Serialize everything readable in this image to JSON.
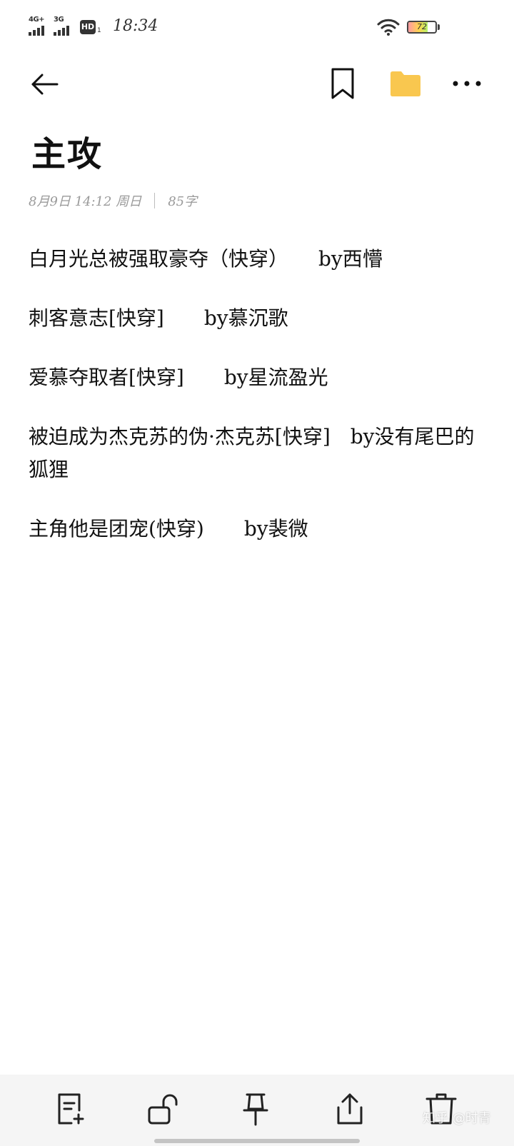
{
  "status_bar": {
    "network_1": "4G+",
    "network_2": "3G",
    "hd_label": "HD",
    "hd_sub": "1",
    "time": "18:34",
    "battery_level": "72",
    "battery_fraction": 0.72
  },
  "toolbar": {
    "back_icon": "arrow-left-icon",
    "bookmark_icon": "bookmark-icon",
    "folder_icon": "folder-icon",
    "folder_color": "#F9C74F",
    "more_icon": "more-horizontal-icon"
  },
  "note": {
    "title": "主攻",
    "date": "8月9日 14:12 周日",
    "word_count": "85字",
    "lines": [
      "白月光总被强取豪夺（快穿）　　by西懵",
      "刺客意志[快穿]　　by慕沉歌",
      "爱慕夺取者[快穿]　　by星流盈光",
      "被迫成为杰克苏的伪·杰克苏[快穿]　by没有尾巴的狐狸",
      "主角他是团宠(快穿)　　by裴微"
    ]
  },
  "bottom_bar": {
    "items": [
      {
        "icon": "new-note-icon"
      },
      {
        "icon": "unlock-icon"
      },
      {
        "icon": "pin-icon"
      },
      {
        "icon": "share-icon"
      },
      {
        "icon": "trash-icon"
      }
    ]
  },
  "watermark": "知乎 @时青"
}
